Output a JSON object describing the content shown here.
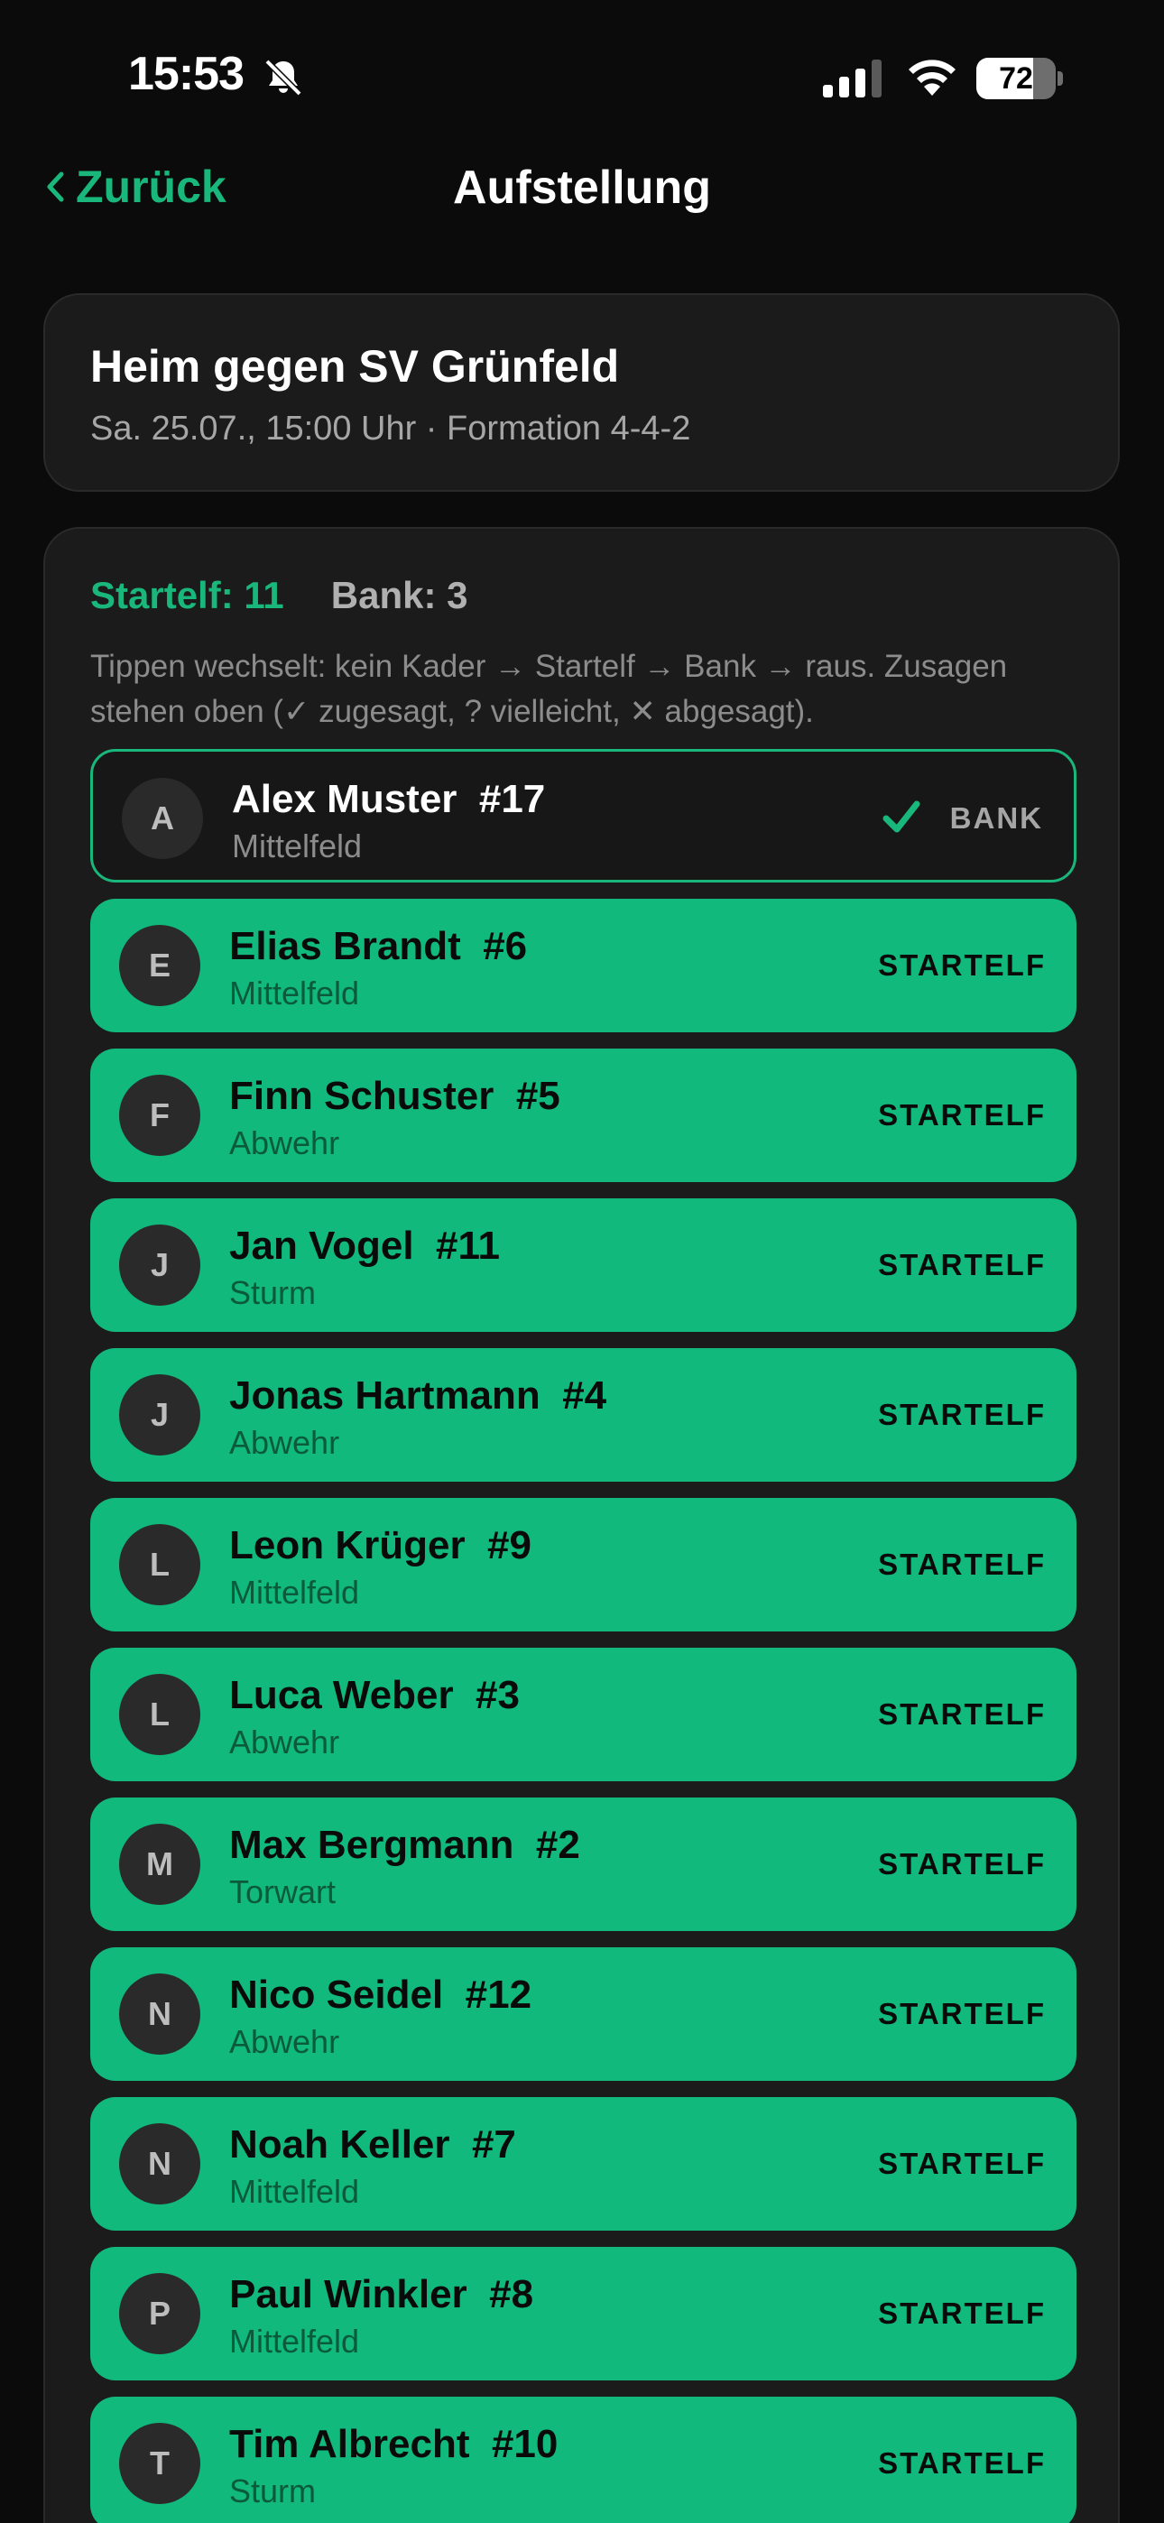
{
  "status_bar": {
    "time": "15:53",
    "battery": "72",
    "battery_level": 0.72
  },
  "nav": {
    "back_label": "Zurück",
    "title": "Aufstellung"
  },
  "match": {
    "title": "Heim gegen SV Grünfeld",
    "subtitle": "Sa. 25.07., 15:00 Uhr · Formation 4-4-2"
  },
  "roster": {
    "starting_count": "Startelf: 11",
    "bench_count": "Bank: 3",
    "hint": "Tippen wechselt: kein Kader → Startelf → Bank → raus. Zusagen stehen oben (✓ zugesagt, ? vielleicht, ✕ abgesagt).",
    "players": [
      {
        "initial": "A",
        "name": "Alex Muster  #17",
        "position": "Mittelfeld",
        "status": "BANK",
        "role": "bench",
        "rsvp": "check-icon"
      },
      {
        "initial": "E",
        "name": "Elias Brandt  #6",
        "position": "Mittelfeld",
        "status": "STARTELF",
        "role": "start"
      },
      {
        "initial": "F",
        "name": "Finn Schuster  #5",
        "position": "Abwehr",
        "status": "STARTELF",
        "role": "start"
      },
      {
        "initial": "J",
        "name": "Jan Vogel  #11",
        "position": "Sturm",
        "status": "STARTELF",
        "role": "start"
      },
      {
        "initial": "J",
        "name": "Jonas Hartmann  #4",
        "position": "Abwehr",
        "status": "STARTELF",
        "role": "start"
      },
      {
        "initial": "L",
        "name": "Leon Krüger  #9",
        "position": "Mittelfeld",
        "status": "STARTELF",
        "role": "start"
      },
      {
        "initial": "L",
        "name": "Luca Weber  #3",
        "position": "Abwehr",
        "status": "STARTELF",
        "role": "start"
      },
      {
        "initial": "M",
        "name": "Max Bergmann  #2",
        "position": "Torwart",
        "status": "STARTELF",
        "role": "start"
      },
      {
        "initial": "N",
        "name": "Nico Seidel  #12",
        "position": "Abwehr",
        "status": "STARTELF",
        "role": "start"
      },
      {
        "initial": "N",
        "name": "Noah Keller  #7",
        "position": "Mittelfeld",
        "status": "STARTELF",
        "role": "start"
      },
      {
        "initial": "P",
        "name": "Paul Winkler  #8",
        "position": "Mittelfeld",
        "status": "STARTELF",
        "role": "start"
      },
      {
        "initial": "T",
        "name": "Tim Albrecht  #10",
        "position": "Sturm",
        "status": "STARTELF",
        "role": "start"
      }
    ]
  },
  "colors": {
    "accent": "#19b77b",
    "start_row": "#11b97d",
    "background": "#0b0b0b",
    "card": "#1b1b1b"
  }
}
